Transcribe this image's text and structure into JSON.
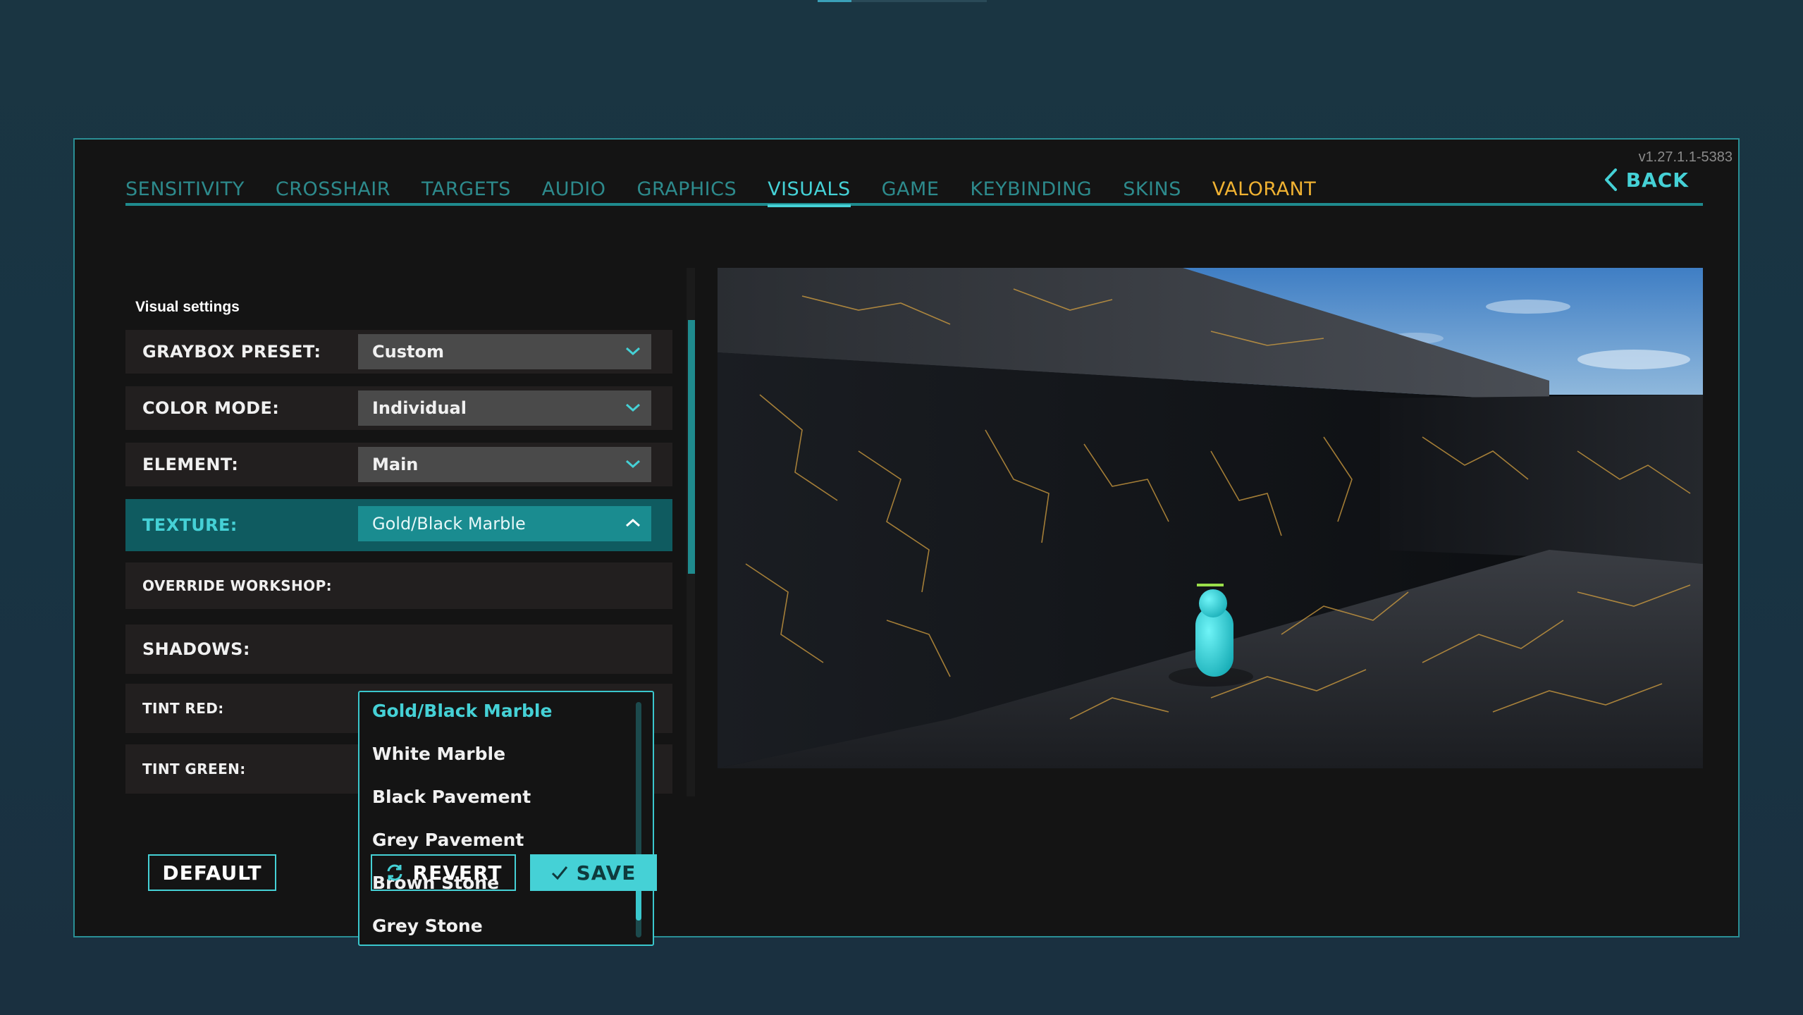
{
  "version": "v1.27.1.1-5383",
  "tabs": [
    {
      "label": "SENSITIVITY",
      "active": false
    },
    {
      "label": "CROSSHAIR",
      "active": false
    },
    {
      "label": "TARGETS",
      "active": false
    },
    {
      "label": "AUDIO",
      "active": false
    },
    {
      "label": "GRAPHICS",
      "active": false
    },
    {
      "label": "VISUALS",
      "active": true
    },
    {
      "label": "GAME",
      "active": false
    },
    {
      "label": "KEYBINDING",
      "active": false
    },
    {
      "label": "SKINS",
      "active": false
    },
    {
      "label": "VALORANT",
      "active": false
    }
  ],
  "back_label": "BACK",
  "section_title": "Visual settings",
  "settings": {
    "graybox_preset": {
      "label": "GRAYBOX PRESET:",
      "value": "Custom"
    },
    "color_mode": {
      "label": "COLOR MODE:",
      "value": "Individual"
    },
    "element": {
      "label": "ELEMENT:",
      "value": "Main"
    },
    "texture": {
      "label": "TEXTURE:",
      "value": "Gold/Black Marble"
    },
    "override_workshop": {
      "label": "OVERRIDE WORKSHOP:"
    },
    "shadows": {
      "label": "SHADOWS:"
    },
    "tint_red": {
      "label": "TINT RED:"
    },
    "tint_green": {
      "label": "TINT GREEN:"
    }
  },
  "texture_options": [
    "Gold/Black Marble",
    "White Marble",
    "Black Pavement",
    "Grey Pavement",
    "Brown Stone",
    "Grey Stone"
  ],
  "texture_selected_index": 0,
  "buttons": {
    "default": "DEFAULT",
    "revert": "REVERT",
    "save": "SAVE"
  },
  "colors": {
    "accent": "#45d1d6",
    "accent_dark": "#1f8b8e",
    "valorant": "#f0b232",
    "panel_bg": "#141414"
  }
}
